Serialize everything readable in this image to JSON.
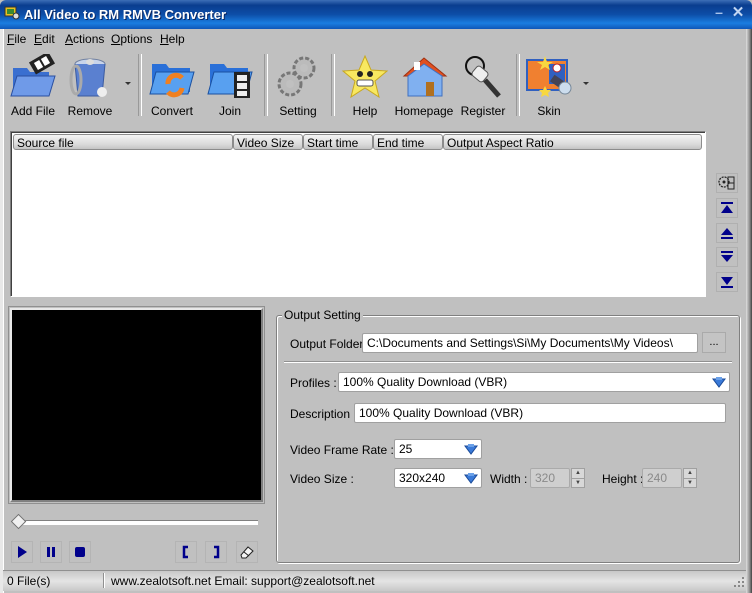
{
  "window": {
    "title": "All Video to RM RMVB Converter",
    "minimize_label": "–",
    "close_label": "✕"
  },
  "menubar": {
    "items": [
      {
        "label": "File",
        "accel": "F"
      },
      {
        "label": "Edit",
        "accel": "E"
      },
      {
        "label": "Actions",
        "accel": "A"
      },
      {
        "label": "Options",
        "accel": "O"
      },
      {
        "label": "Help",
        "accel": "H"
      }
    ]
  },
  "toolbar": {
    "add_file": "Add File",
    "remove": "Remove",
    "convert": "Convert",
    "join": "Join",
    "setting": "Setting",
    "help": "Help",
    "homepage": "Homepage",
    "register": "Register",
    "skin": "Skin"
  },
  "file_list": {
    "columns": [
      "Source file",
      "Video Size",
      "Start time",
      "End time",
      "Output Aspect Ratio"
    ],
    "rows": []
  },
  "side_buttons": {
    "icons": [
      "properties-icon",
      "move-top-icon",
      "move-up-icon",
      "move-down-icon",
      "move-bottom-icon"
    ]
  },
  "player": {
    "position": 0
  },
  "output_setting": {
    "group_label": "Output Setting",
    "output_folder_label": "Output Folder:",
    "output_folder_value": "C:\\Documents and Settings\\Si\\My Documents\\My Videos\\",
    "browse_label": "...",
    "profiles_label": "Profiles :",
    "profiles_value": "100% Quality Download (VBR)",
    "description_label": "Description :",
    "description_value": "100% Quality Download (VBR)",
    "frame_rate_label": "Video Frame Rate :",
    "frame_rate_value": "25",
    "video_size_label": "Video Size :",
    "video_size_value": "320x240",
    "width_label": "Width :",
    "width_value": "320",
    "height_label": "Height :",
    "height_value": "240"
  },
  "statusbar": {
    "files": "0 File(s)",
    "contact": "www.zealotsoft.net   Email: support@zealotsoft.net"
  },
  "colors": {
    "titlebar": "#0d4ea8",
    "face": "#c0c0c0",
    "nav_icon": "#00008b",
    "preview_bg": "#000000"
  }
}
